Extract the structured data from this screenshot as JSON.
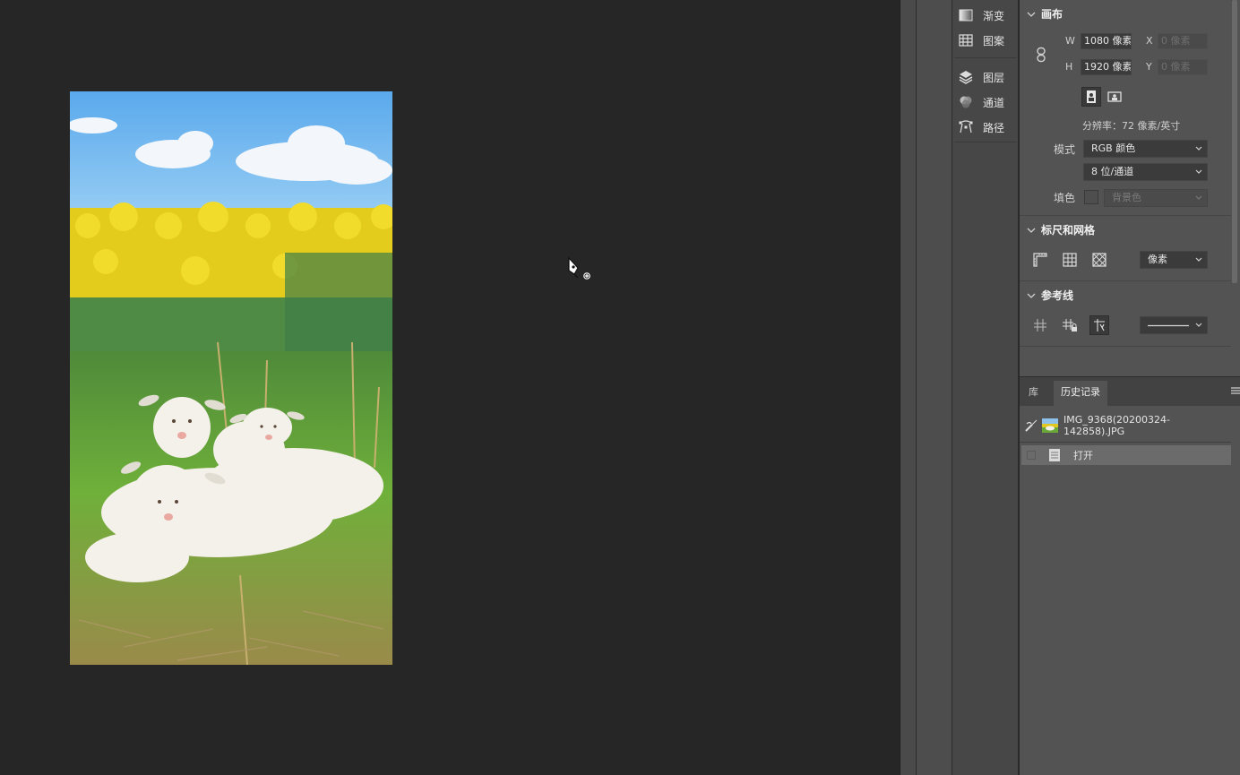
{
  "dock": {
    "items": [
      {
        "label": "渐变",
        "icon": "gradient-icon"
      },
      {
        "label": "图案",
        "icon": "pattern-icon"
      },
      {
        "label": "图层",
        "icon": "layers-icon"
      },
      {
        "label": "通道",
        "icon": "channels-icon"
      },
      {
        "label": "路径",
        "icon": "paths-icon"
      }
    ]
  },
  "canvas_section": {
    "title": "画布",
    "w_label": "W",
    "w_value": "1080 像素",
    "h_label": "H",
    "h_value": "1920 像素",
    "x_label": "X",
    "x_value": "0 像素",
    "y_label": "Y",
    "y_value": "0 像素",
    "resolution": "分辨率：72 像素/英寸",
    "mode_label": "模式",
    "mode_value": "RGB 颜色",
    "bitdepth_value": "8 位/通道",
    "fill_label": "填色",
    "fill_value": "背景色"
  },
  "rulers_section": {
    "title": "标尺和网格",
    "unit_value": "像素"
  },
  "guides_section": {
    "title": "参考线"
  },
  "history_panel": {
    "tabs": [
      "库",
      "历史记录"
    ],
    "active_tab": "历史记录",
    "snapshot_name": "IMG_9368(20200324-142858).JPG",
    "steps": [
      "打开"
    ]
  },
  "colors": {
    "workspace": "#262626",
    "panel": "#535353",
    "dock": "#474747"
  }
}
